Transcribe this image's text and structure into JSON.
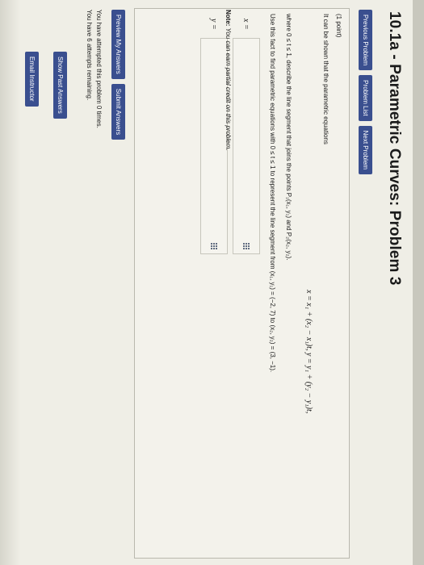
{
  "title": "10.1a - Parametric Curves: Problem 3",
  "nav": {
    "previous": "Previous Problem",
    "list": "Problem List",
    "next": "Next Problem"
  },
  "problem": {
    "points": "(1 point)",
    "statement": "It can be shown that the parametric equations",
    "equation": "x = x₁ + (x₂ − x₁)t,   y = y₁ + (y₂ − y₁)t,",
    "where": "where 0 ≤ t ≤ 1, describe the line segment that joins the points P₁(x₁, y₁) and P₂(x₂, y₂).",
    "use_fact": "Use this fact to find parametric equations with 0 ≤ t ≤ 1 to represent the line segment from (x₁, y₁) = (−2, 7) to (x₂, y₂) = (3, −1).",
    "x_label": "x =",
    "y_label": "y =",
    "x_value": "",
    "y_value": ""
  },
  "note": {
    "prefix": "Note:",
    "text": " You can earn partial credit on this problem."
  },
  "actions": {
    "preview": "Preview My Answers",
    "submit": "Submit Answers"
  },
  "status": {
    "attempted": "You have attempted this problem 0 times.",
    "remaining": "You have 6 attempts remaining."
  },
  "links": {
    "show_past": "Show Past Answers",
    "email": "Email Instructor"
  },
  "colors": {
    "button": "#3a4f8f",
    "background": "#efeee6"
  },
  "icons": [
    "equation-editor-icon"
  ]
}
